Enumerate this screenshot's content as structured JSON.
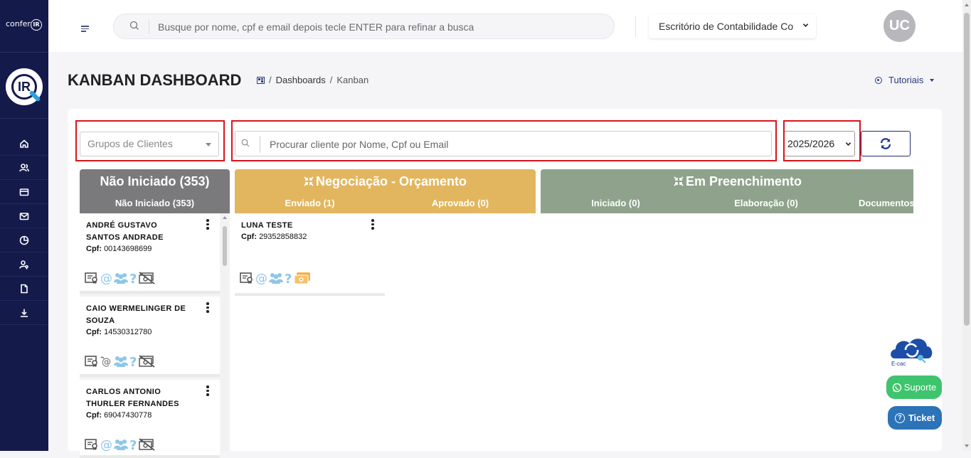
{
  "sidebar": {
    "logo_text": "confer",
    "logo_badge": "IR",
    "big_logo": "IR",
    "nav_icons": [
      "home-icon",
      "users-icon",
      "card-icon",
      "mail-icon",
      "chart-pie-icon",
      "user-key-icon",
      "document-icon",
      "download-icon"
    ]
  },
  "topbar": {
    "search_placeholder": "Busque por nome, cpf e email depois tecle ENTER para refinar a busca",
    "office": "Escritório de Contabilidade Co",
    "avatar": "UC"
  },
  "page": {
    "title": "KANBAN DASHBOARD",
    "breadcrumb": [
      "Dashboards",
      "Kanban"
    ],
    "breadcrumb_sep": "/",
    "tutoriais": "Tutoriais"
  },
  "filters": {
    "grupo_placeholder": "Grupos de Clientes",
    "cliente_placeholder": "Procurar cliente por Nome, Cpf ou Email",
    "year": "2025/2026"
  },
  "columns": {
    "nao_iniciado": {
      "title": "Não Iniciado (353)",
      "subs": [
        "Não Iniciado (353)"
      ],
      "color": "#7a7a7d"
    },
    "negociacao": {
      "title": "Negociação - Orçamento",
      "subs": [
        "Enviado (1)",
        "Aprovado (0)"
      ],
      "color": "#e2b65f"
    },
    "preenchimento": {
      "title": "Em Preenchimento",
      "subs": [
        "Iniciado (0)",
        "Elaboração (0)",
        "Documentos"
      ],
      "color": "#8fa38c"
    }
  },
  "cards": [
    {
      "name": "ANDRÉ GUSTAVO SANTOS ANDRADE",
      "cpf_label": "Cpf:",
      "cpf": "00143698699"
    },
    {
      "name": "CAIO WERMELINGER DE SOUZA",
      "cpf_label": "Cpf:",
      "cpf": "14530312780"
    },
    {
      "name": "CARLOS ANTONIO THURLER FERNANDES",
      "cpf_label": "Cpf:",
      "cpf": "69047430778"
    },
    {
      "name": "LUNA TESTE",
      "cpf_label": "Cpf:",
      "cpf": "29352858832"
    }
  ],
  "floating": {
    "ecac": "E-cac",
    "suporte": "Suporte",
    "ticket": "Ticket",
    "ticket_icon": "?"
  }
}
